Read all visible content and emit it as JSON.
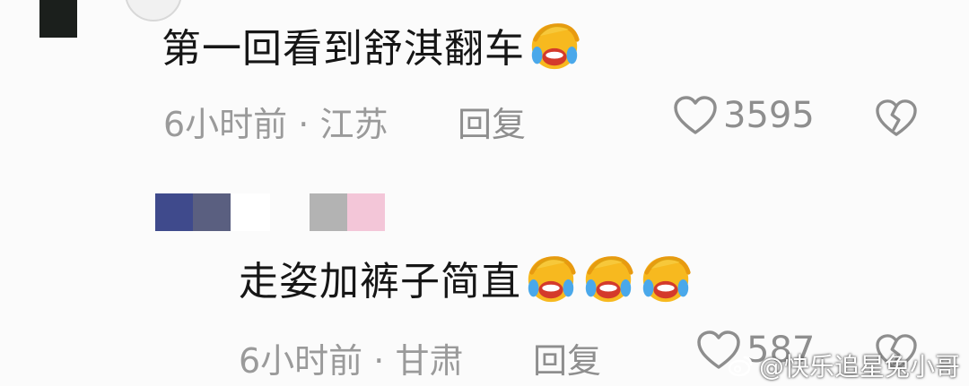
{
  "comment1": {
    "text": "第一回看到舒淇翻车",
    "emoji": "rofl-face-icon",
    "time": "6小时前",
    "separator": "·",
    "location": "江苏",
    "reply_label": "回复",
    "like_count": "3595"
  },
  "comment2": {
    "text": "走姿加裤子简直",
    "emoji_count": 3,
    "time": "6小时前",
    "separator": "·",
    "location": "甘肃",
    "reply_label": "回复",
    "like_count": "587"
  },
  "watermark": {
    "text": "@快乐追星兔小哥"
  },
  "colors": {
    "text_primary": "#161616",
    "text_secondary": "#9a9a9a",
    "avatar_dark": "#1b1f1c",
    "username_block_1": "#3f4a8c",
    "username_block_2": "#5a5f80",
    "username_block_3": "#b3b3b3",
    "username_block_4": "#f3c6d8"
  }
}
